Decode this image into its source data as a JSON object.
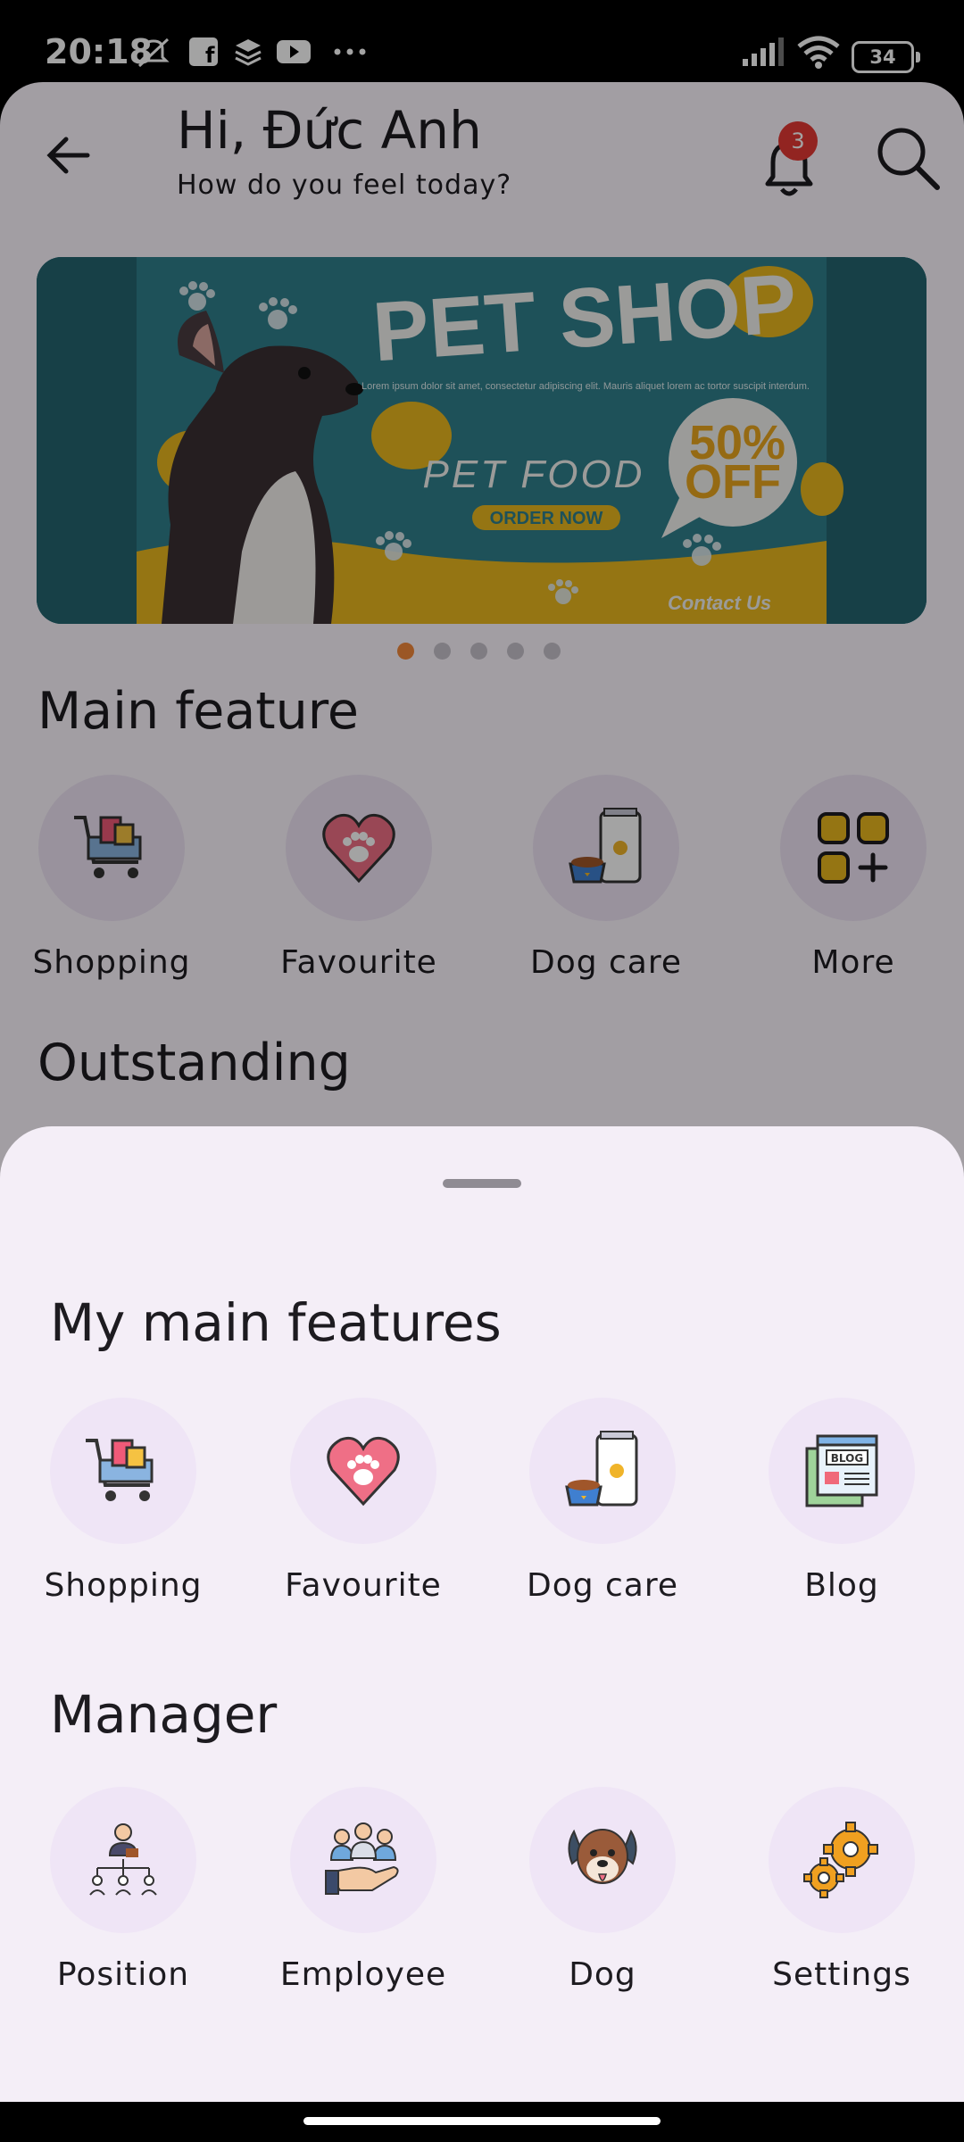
{
  "status_bar": {
    "time": "20:18",
    "battery": "34"
  },
  "header": {
    "title": "Hi, Đức Anh",
    "subtitle": "How do you feel today?",
    "notification_count": "3"
  },
  "banner": {
    "headline": "PET SHOP",
    "body": "Lorem ipsum dolor sit amet, consectetur adipiscing elit. Mauris aliquet lorem ac tortor suscipit interdum.",
    "product": "PET FOOD",
    "cta": "ORDER NOW",
    "discount_value": "50%",
    "discount_word": "OFF",
    "contact": "Contact Us",
    "slide_count": 5,
    "active_slide": 1
  },
  "main_feature": {
    "title": "Main feature",
    "items": [
      {
        "label": "Shopping",
        "icon": "shopping-cart-icon"
      },
      {
        "label": "Favourite",
        "icon": "heart-paw-icon"
      },
      {
        "label": "Dog care",
        "icon": "pet-food-bag-icon"
      },
      {
        "label": "More",
        "icon": "grid-plus-icon"
      }
    ]
  },
  "outstanding": {
    "title": "Outstanding"
  },
  "sheet": {
    "my_features_title": "My main features",
    "my_features": [
      {
        "label": "Shopping",
        "icon": "shopping-cart-icon"
      },
      {
        "label": "Favourite",
        "icon": "heart-paw-icon"
      },
      {
        "label": "Dog care",
        "icon": "pet-food-bag-icon"
      },
      {
        "label": "Blog",
        "icon": "blog-icon"
      }
    ],
    "manager_title": "Manager",
    "manager": [
      {
        "label": "Position",
        "icon": "org-chart-icon"
      },
      {
        "label": "Employee",
        "icon": "employee-hand-icon"
      },
      {
        "label": "Dog",
        "icon": "dog-face-icon"
      },
      {
        "label": "Settings",
        "icon": "gears-icon"
      }
    ]
  },
  "colors": {
    "accent": "#f2883a",
    "badge": "#e53935",
    "sheet_bg": "#f4eef7",
    "icon_circle": "#efe5f6"
  }
}
